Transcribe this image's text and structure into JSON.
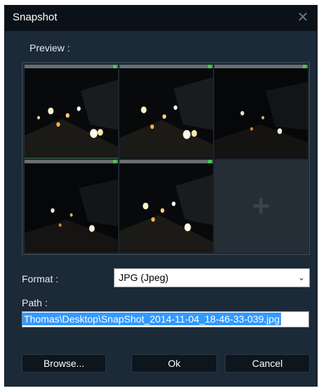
{
  "dialog": {
    "title": "Snapshot",
    "close_icon": "close-icon"
  },
  "preview": {
    "label": "Preview :",
    "add_icon": "plus-icon",
    "add_glyph": "+"
  },
  "form": {
    "format_label": "Format :",
    "format_value": "JPG (Jpeg)",
    "path_label": "Path :",
    "path_value": "Thomas\\Desktop\\SnapShot_2014-11-04_18-46-33-039.jpg"
  },
  "buttons": {
    "browse": "Browse...",
    "ok": "Ok",
    "cancel": "Cancel"
  },
  "colors": {
    "dialog_bg": "#1c2937",
    "titlebar_bg": "#0b1118",
    "selection": "#3399ff",
    "selected_tile": "#4ec24e"
  }
}
